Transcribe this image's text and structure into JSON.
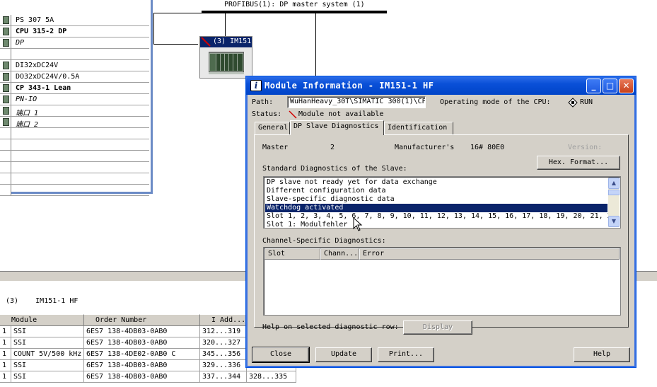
{
  "rack": {
    "rows": [
      {
        "text": "PS 307 5A",
        "style": "normal"
      },
      {
        "text": "CPU 315-2 DP",
        "style": "bold"
      },
      {
        "text": "DP",
        "style": "italic"
      },
      {
        "text": "",
        "style": "normal"
      },
      {
        "text": "DI32xDC24V",
        "style": "normal"
      },
      {
        "text": "DO32xDC24V/0.5A",
        "style": "normal"
      },
      {
        "text": "CP 343-1 Lean",
        "style": "bold"
      },
      {
        "text": "PN-IO",
        "style": "italic"
      },
      {
        "text": "端口 1",
        "style": "italic"
      },
      {
        "text": "端口 2",
        "style": "italic"
      },
      {
        "text": "",
        "style": "normal"
      },
      {
        "text": "",
        "style": "normal"
      },
      {
        "text": "",
        "style": "normal"
      },
      {
        "text": "",
        "style": "normal"
      },
      {
        "text": "",
        "style": "normal"
      },
      {
        "text": "",
        "style": "normal"
      }
    ]
  },
  "network": {
    "bus_label": "PROFIBUS(1): DP master system (1)"
  },
  "slave_icon": {
    "title": "(3) IM151"
  },
  "bottom": {
    "title_index": "(3)",
    "title_name": "IM151-1 HF",
    "headers": [
      "Module",
      "Order Number",
      "I Add..."
    ],
    "rows": [
      {
        "slot": "1",
        "module": "SSI",
        "order": "6ES7 138-4DB03-0AB0",
        "iaddr": "312...319",
        "extra": ""
      },
      {
        "slot": "1",
        "module": "SSI",
        "order": "6ES7 138-4DB03-0AB0",
        "iaddr": "320...327",
        "extra": ""
      },
      {
        "slot": "1",
        "module": "COUNT 5V/500 kHz",
        "order": "6ES7 138-4DE02-0AB0 C",
        "iaddr": "345...356",
        "extra": ""
      },
      {
        "slot": "1",
        "module": "SSI",
        "order": "6ES7 138-4DB03-0AB0",
        "iaddr": "329...336",
        "extra": ""
      },
      {
        "slot": "1",
        "module": "SSI",
        "order": "6ES7 138-4DB03-0AB0",
        "iaddr": "337...344",
        "extra": "328...335"
      }
    ]
  },
  "dialog": {
    "title": "Module Information - IM151-1 HF",
    "path_label": "Path:",
    "path_value": "WuHanHeavy_30T\\SIMATIC 300(1)\\CP",
    "operating_mode_label": "Operating mode of the  CPU:",
    "operating_mode_value": "RUN",
    "status_label": "Status:",
    "status_value": "Module not available",
    "tabs": [
      "General",
      "DP Slave Diagnostics",
      "Identification"
    ],
    "master_label": "Master",
    "master_value": "2",
    "manufacturer_label": "Manufacturer's",
    "manufacturer_value": "16# 80E0",
    "version_label": "Version:",
    "hex_format_button": "Hex. Format...",
    "std_diag_label": "Standard Diagnostics of the Slave:",
    "diag_items": [
      "DP slave not ready yet for data exchange",
      "Different configuration data",
      "Slave-specific diagnostic data",
      "Watchdog activated",
      "Slot 1, 2, 3, 4, 5, 6, 7, 8, 9, 10, 11, 12, 13, 14, 15, 16, 17, 18, 19, 20, 21, 2",
      "Slot 1: Modulfehler"
    ],
    "selected_diag_index": 3,
    "channel_label": "Channel-Specific Diagnostics:",
    "channel_headers": [
      "Slot",
      "Chann...",
      "Error"
    ],
    "help_row_label": "Help on selected diagnostic row:",
    "display_button": "Display",
    "close_button": "Close",
    "update_button": "Update",
    "print_button": "Print...",
    "help_button": "Help"
  },
  "colors": {
    "titlebar": "#0a50d8",
    "selection": "#0a246a",
    "dialog_bg": "#d4d0c8",
    "rack_border": "#6b8bc6"
  }
}
